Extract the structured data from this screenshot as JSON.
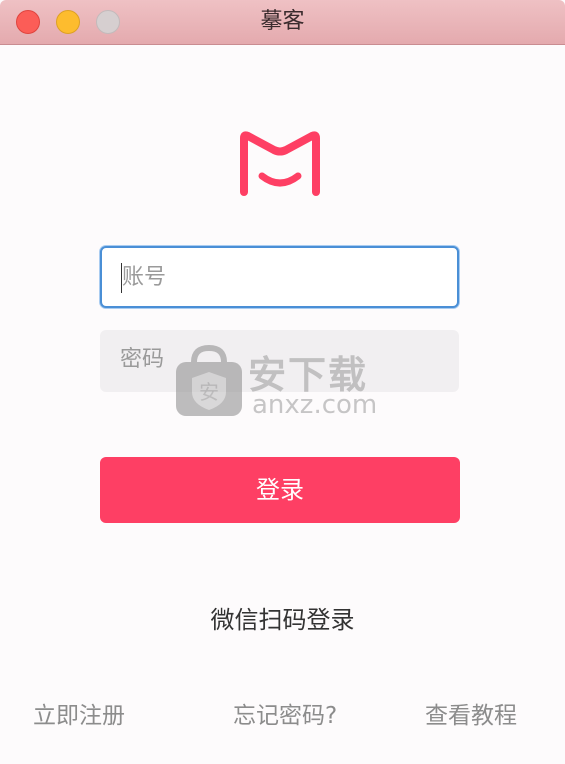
{
  "window": {
    "title": "摹客"
  },
  "icons": {
    "logo": "moke-m-logo-icon",
    "close": "window-close-icon",
    "minimize": "window-minimize-icon",
    "maximize": "window-maximize-icon"
  },
  "colors": {
    "brand": "#fe3f64",
    "focus_border": "#4a8fd6",
    "titlebar": "#e9b5b9"
  },
  "form": {
    "account_placeholder": "账号",
    "password_placeholder": "密码",
    "login_label": "登录"
  },
  "wechat_login": "微信扫码登录",
  "footer": {
    "register": "立即注册",
    "forgot_password": "忘记密码?",
    "tutorial": "查看教程"
  },
  "watermark": {
    "brand": "安下载",
    "domain": "anxz.com",
    "badge": "安"
  }
}
